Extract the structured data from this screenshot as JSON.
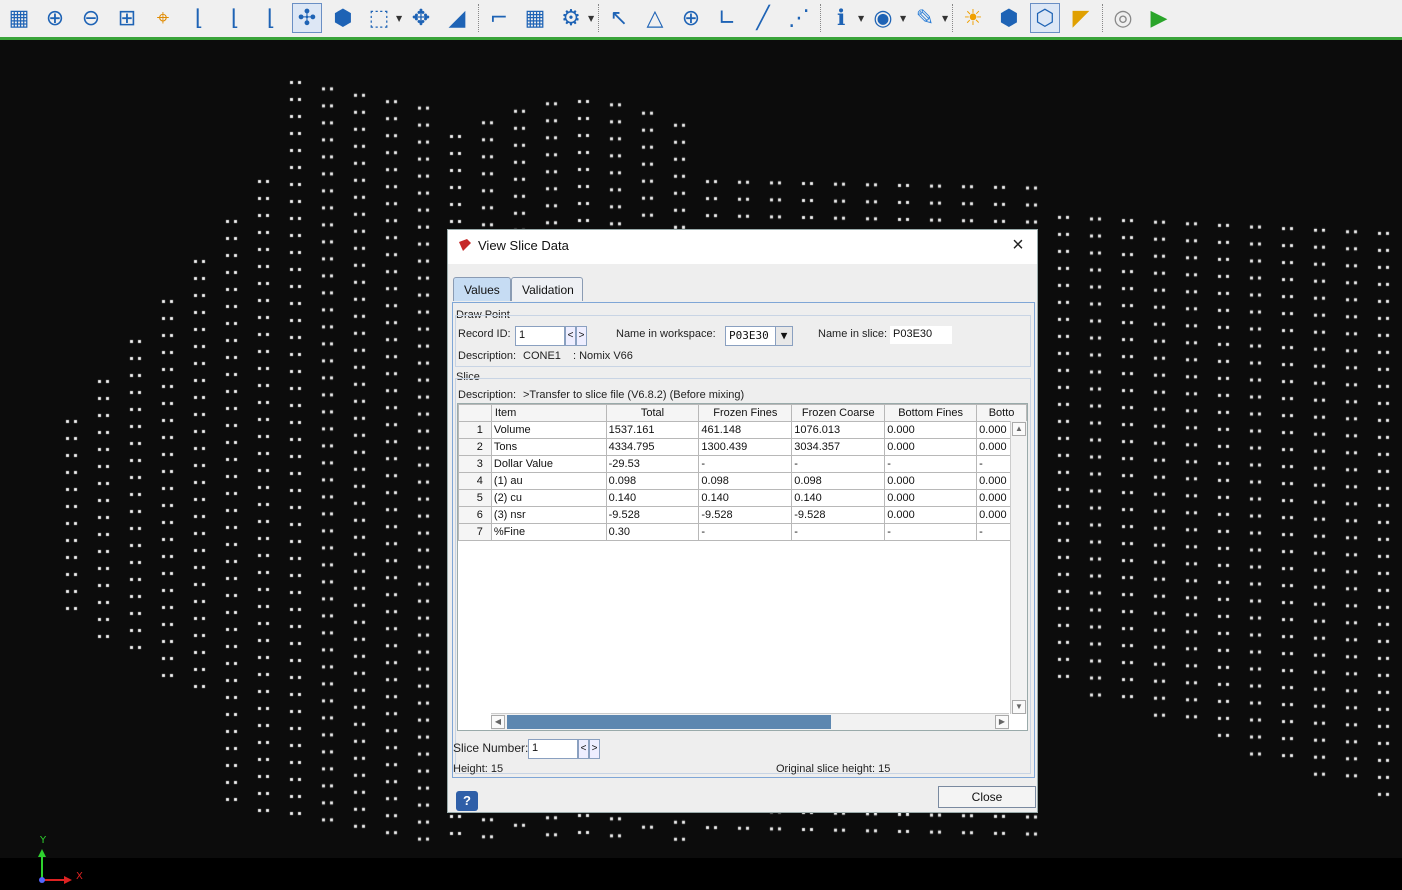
{
  "toolbar": {
    "icons": [
      "grid-icon",
      "zoom-in-icon",
      "zoom-out-icon",
      "zoom-extents-icon",
      "target-icon",
      "view-yx-icon",
      "view-zx-icon",
      "view-zy-icon",
      "rotate-3d-icon",
      "select-object-icon",
      "select-box-icon",
      "pan-icon",
      "measure-angle-icon",
      "point-select-icon",
      "grid-select-icon",
      "string-edit-icon",
      "point-add-icon",
      "polygon-edit-icon",
      "point-insert-icon",
      "line-edit-icon",
      "line-split-icon",
      "vertex-edit-icon",
      "info-icon",
      "visibility-icon",
      "pencil-icon",
      "lighting-icon",
      "solid-hex-icon",
      "wireframe-hex-icon",
      "pen-plane-icon",
      "record-icon",
      "play-icon"
    ]
  },
  "viewport": {
    "axis": {
      "y_label": "Y",
      "x_label": "X"
    }
  },
  "dialog": {
    "title": "View Slice Data",
    "close_x": "×",
    "tabs": [
      "Values",
      "Validation"
    ],
    "draw_point": {
      "group_label": "Draw Point",
      "record_id_label": "Record ID:",
      "record_id_value": "1",
      "prev": "<",
      "next": ">",
      "name_in_workspace_label": "Name in workspace:",
      "name_in_workspace_value": "P03E30",
      "name_in_slice_label": "Name in slice:",
      "name_in_slice_value": "P03E30",
      "description_label": "Description:",
      "description_value": "CONE1",
      "description_extra": ": Nomix V66"
    },
    "slice": {
      "group_label": "Slice",
      "description_label": "Description:",
      "description_value": ">Transfer to slice file (V6.8.2) (Before mixing)",
      "table": {
        "columns": [
          "Item",
          "Total",
          "Frozen Fines",
          "Frozen Coarse",
          "Bottom Fines",
          "Botto"
        ],
        "rows": [
          [
            "1",
            "Volume",
            "1537.161",
            "461.148",
            "1076.013",
            "0.000",
            "0.000"
          ],
          [
            "2",
            "Tons",
            "4334.795",
            "1300.439",
            "3034.357",
            "0.000",
            "0.000"
          ],
          [
            "3",
            "Dollar Value",
            "-29.53",
            "-",
            "-",
            "-",
            "-"
          ],
          [
            "4",
            "(1) au",
            "0.098",
            "0.098",
            "0.098",
            "0.000",
            "0.000"
          ],
          [
            "5",
            "(2) cu",
            "0.140",
            "0.140",
            "0.140",
            "0.000",
            "0.000"
          ],
          [
            "6",
            "(3) nsr",
            "-9.528",
            "-9.528",
            "-9.528",
            "0.000",
            "0.000"
          ],
          [
            "7",
            "%Fine",
            "0.30",
            "-",
            "-",
            "-",
            "-"
          ]
        ]
      }
    },
    "slice_number_label": "Slice Number:",
    "slice_number_value": "1",
    "height_label": "Height: 15",
    "original_height_label": "Original slice height: 15",
    "help": "?",
    "close_button": "Close"
  }
}
